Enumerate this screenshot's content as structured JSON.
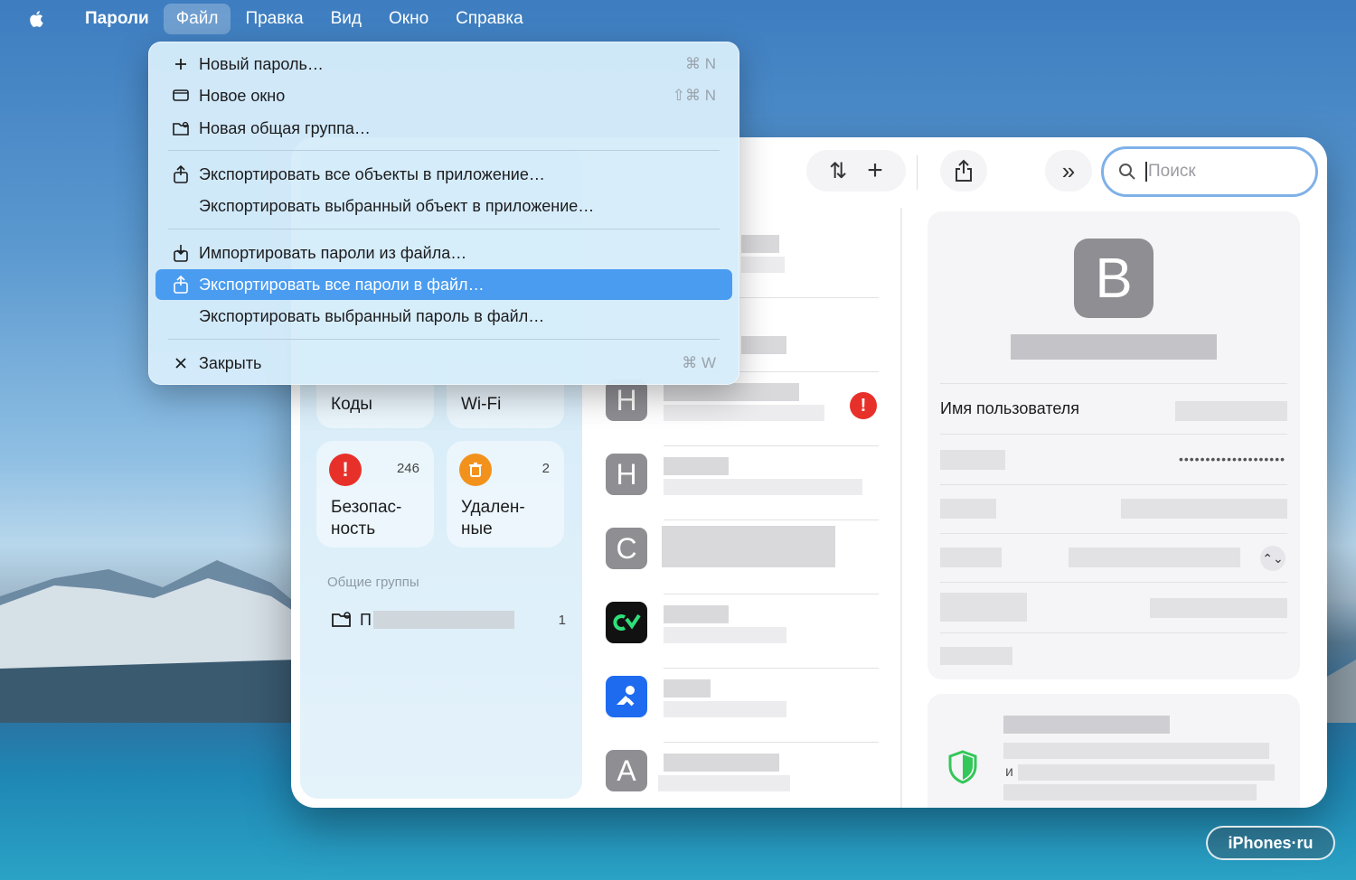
{
  "menubar": {
    "app_name": "Пароли",
    "items": [
      "Файл",
      "Правка",
      "Вид",
      "Окно",
      "Справка"
    ]
  },
  "file_menu": {
    "items": [
      {
        "label": "Новый пароль…",
        "shortcut": "⌘ N",
        "icon": "plus-icon"
      },
      {
        "label": "Новое окно",
        "shortcut": "⇧⌘ N",
        "icon": "new-window-icon"
      },
      {
        "label": "Новая общая группа…",
        "shortcut": "",
        "icon": "shared-group-icon"
      },
      {
        "label": "Экспортировать все объекты в приложение…",
        "shortcut": "",
        "icon": "export-app-icon"
      },
      {
        "label": "Экспортировать выбранный объект в приложение…",
        "shortcut": "",
        "icon": ""
      },
      {
        "label": "Импортировать пароли из файла…",
        "shortcut": "",
        "icon": "import-icon"
      },
      {
        "label": "Экспортировать все пароли в файл…",
        "shortcut": "",
        "icon": "export-file-icon"
      },
      {
        "label": "Экспортировать выбранный пароль в файл…",
        "shortcut": "",
        "icon": ""
      },
      {
        "label": "Закрыть",
        "shortcut": "⌘ W",
        "icon": "close-icon"
      }
    ],
    "highlighted_index": 6
  },
  "sidebar": {
    "tiles": [
      {
        "label": "Коды",
        "count": ""
      },
      {
        "label": "Wi-Fi",
        "count": ""
      },
      {
        "label": "Безопас-\nность",
        "count": "246",
        "icon": "alert-icon",
        "color": "#e8302a"
      },
      {
        "label": "Удален-\nные",
        "count": "2",
        "icon": "trash-icon",
        "color": "#f2921d"
      }
    ],
    "section_title": "Общие группы",
    "group": {
      "name_initial": "П",
      "count": "1"
    }
  },
  "toolbar": {
    "search_placeholder": "Поиск"
  },
  "list": {
    "rows": [
      {
        "letter": "",
        "alert": false
      },
      {
        "letter": "",
        "alert": false
      },
      {
        "letter": "H",
        "alert": true
      },
      {
        "letter": "H",
        "alert": false
      },
      {
        "letter": "C",
        "alert": false
      },
      {
        "letter": "",
        "icon": "app-icon-green",
        "alert": false
      },
      {
        "letter": "",
        "icon": "app-icon-blue",
        "alert": false
      },
      {
        "letter": "A",
        "alert": false
      }
    ]
  },
  "detail": {
    "avatar_letter": "B",
    "username_label": "Имя пользователя",
    "password_mask": "••••••••••••••••••••",
    "security_note_prefix": "и"
  },
  "watermark": "iPhones·ru",
  "colors": {
    "accent": "#4a9cf0",
    "alert": "#e8302a",
    "trash": "#f2921d",
    "shield": "#34c759"
  }
}
